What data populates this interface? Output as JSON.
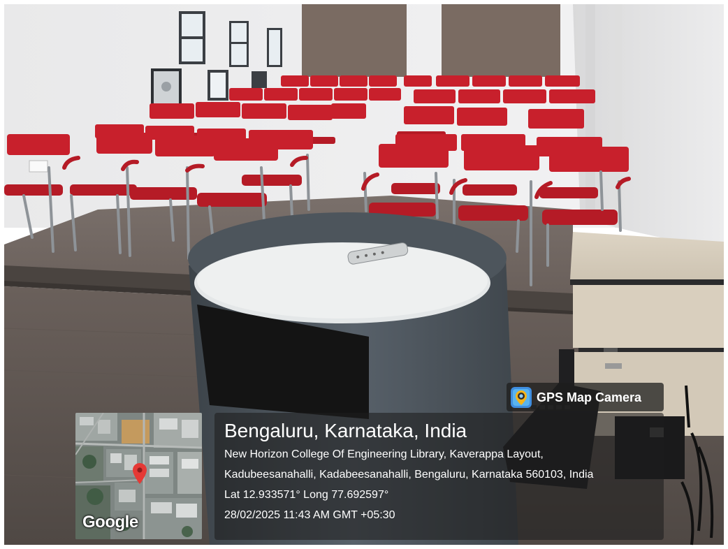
{
  "photo": {
    "subject": "Seminar room with rows of red chairs, grey podium with a remote, side cabinet and keyboard"
  },
  "map_thumbnail": {
    "logo_text": "Google",
    "pin_icon": "map-pin-icon",
    "pin_color": "#e53935"
  },
  "gps_overlay": {
    "title": "Bengaluru, Karnataka, India",
    "address_line1": "New Horizon College Of Engineering Library, Kaverappa Layout,",
    "address_line2": "Kadubeesanahalli, Kadabeesanahalli, Bengaluru, Karnataka 560103, India",
    "coordinates": "Lat 12.933571° Long 77.692597°",
    "timestamp": "28/02/2025 11:43 AM GMT +05:30"
  },
  "badge": {
    "icon": "gps-map-camera-icon",
    "label": "GPS Map Camera"
  },
  "colors": {
    "chair_red": "#c8202c",
    "overlay_bg": "rgba(30,30,30,0.58)",
    "podium_grey": "#5a636b"
  }
}
